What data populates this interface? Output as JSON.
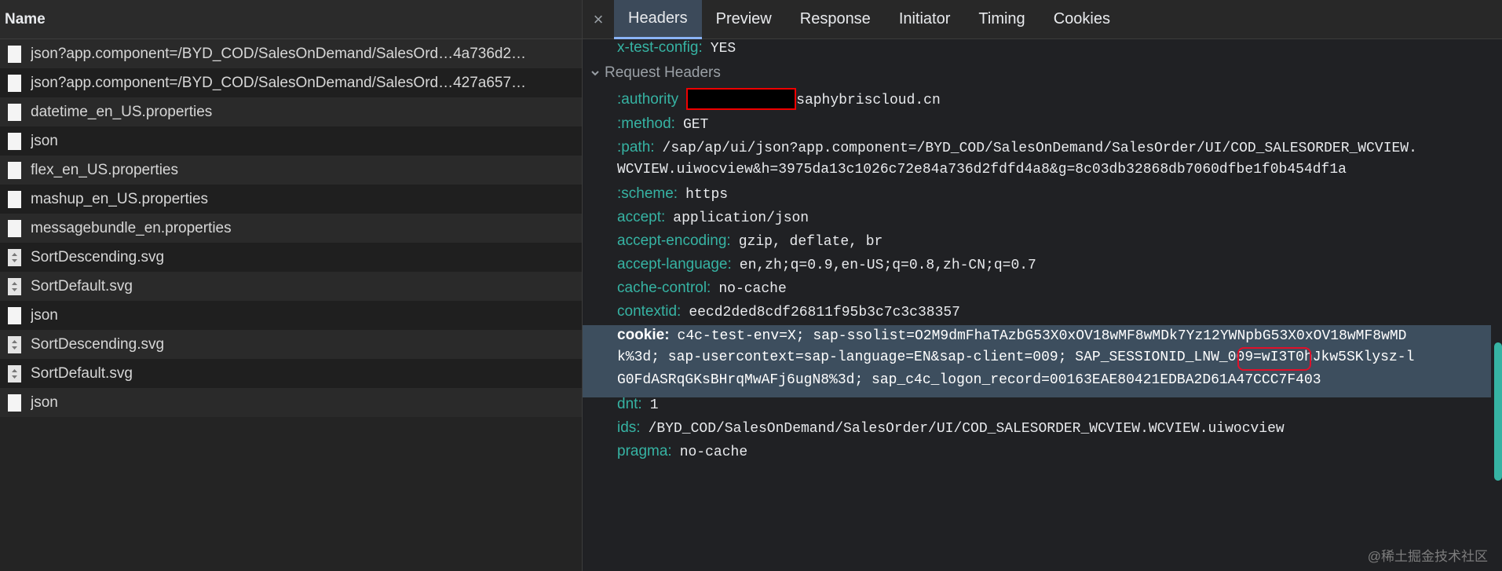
{
  "left": {
    "header": "Name",
    "rows": [
      {
        "name": "json?app.component=/BYD_COD/SalesOnDemand/SalesOrd…4a736d2…",
        "icon": "file-icon"
      },
      {
        "name": "json?app.component=/BYD_COD/SalesOnDemand/SalesOrd…427a657…",
        "icon": "file-icon"
      },
      {
        "name": "datetime_en_US.properties",
        "icon": "file-icon"
      },
      {
        "name": "json",
        "icon": "file-icon"
      },
      {
        "name": "flex_en_US.properties",
        "icon": "file-icon"
      },
      {
        "name": "mashup_en_US.properties",
        "icon": "file-icon"
      },
      {
        "name": "messagebundle_en.properties",
        "icon": "file-icon"
      },
      {
        "name": "SortDescending.svg",
        "icon": "svg-file-icon"
      },
      {
        "name": "SortDefault.svg",
        "icon": "svg-file-icon"
      },
      {
        "name": "json",
        "icon": "file-icon"
      },
      {
        "name": "SortDescending.svg",
        "icon": "svg-file-icon"
      },
      {
        "name": "SortDefault.svg",
        "icon": "svg-file-icon"
      },
      {
        "name": "json",
        "icon": "file-icon"
      }
    ]
  },
  "tabs": {
    "close": "×",
    "items": [
      "Headers",
      "Preview",
      "Response",
      "Initiator",
      "Timing",
      "Cookies"
    ],
    "active": "Headers"
  },
  "headers": {
    "top": {
      "key": "x-test-config:",
      "value": "YES"
    },
    "section_title": "Request Headers",
    "authority": {
      "key": ":authority",
      "value": "saphybriscloud.cn"
    },
    "method": {
      "key": ":method:",
      "value": "GET"
    },
    "path": {
      "key": ":path:",
      "value_line1": "/sap/ap/ui/json?app.component=/BYD_COD/SalesOnDemand/SalesOrder/UI/COD_SALESORDER_WCVIEW.",
      "value_line2": "WCVIEW.uiwocview&h=3975da13c1026c72e84a736d2fdfd4a8&g=8c03db32868db7060dfbe1f0b454df1a"
    },
    "scheme": {
      "key": ":scheme:",
      "value": "https"
    },
    "accept": {
      "key": "accept:",
      "value": "application/json"
    },
    "accept_encoding": {
      "key": "accept-encoding:",
      "value": "gzip, deflate, br"
    },
    "accept_language": {
      "key": "accept-language:",
      "value": "en,zh;q=0.9,en-US;q=0.8,zh-CN;q=0.7"
    },
    "cache_control": {
      "key": "cache-control:",
      "value": "no-cache"
    },
    "contextid": {
      "key": "contextid:",
      "value": "eecd2ded8cdf26811f95b3c7c3c38357"
    },
    "cookie": {
      "key": "cookie:",
      "line1": "c4c-test-env=X; sap-ssolist=O2M9dmFhaTAzbG53X0xOV18wMF8wMDk7Yz12YWNpbG53X0xOV18wMF8wMD",
      "line2": "k%3d; sap-usercontext=sap-language=EN&sap-client=009; SAP_SESSIONID_LNW_009=wI3T0hJkw5SKlysz-l",
      "line3": "G0FdASRqGKsBHrqMwAFj6ugN8%3d; sap_c4c_logon_record=00163EAE80421EDBA2D61A47CCC7F403"
    },
    "dnt": {
      "key": "dnt:",
      "value": "1"
    },
    "ids": {
      "key": "ids:",
      "value": "/BYD_COD/SalesOnDemand/SalesOrder/UI/COD_SALESORDER_WCVIEW.WCVIEW.uiwocview"
    },
    "pragma": {
      "key": "pragma:",
      "value": "no-cache"
    }
  },
  "watermark": "@稀土掘金技术社区",
  "colors": {
    "header_key": "#36b3a3",
    "active_tab": "#3c4a5a",
    "highlight_row": "#3d4e5e",
    "annotation_red": "#e0102a"
  }
}
